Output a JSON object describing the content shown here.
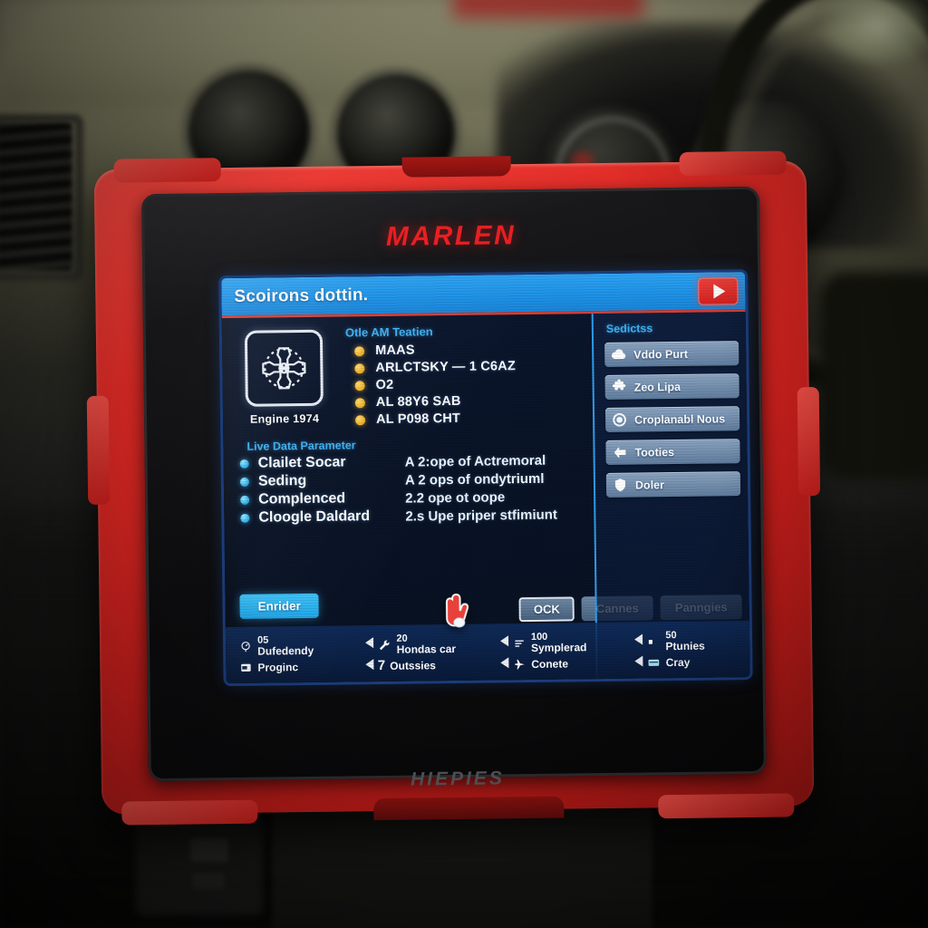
{
  "device": {
    "brand_top": "MARLEN",
    "brand_bottom": "HIEPIES",
    "shell_color": "#e02a25"
  },
  "screen": {
    "titlebar": {
      "title": "Scoirons dottin.",
      "play_icon": "play-icon",
      "bg_color": "#1e93e8",
      "underline_color": "#cf4038"
    },
    "module": {
      "icon_name": "engine-icon",
      "label": "Engine 1974"
    },
    "dtc": {
      "heading": "Otle AM Teatien",
      "bullet_color": "#f0b32c",
      "items": [
        "MAAS",
        "ARLCTSKY — 1 C6AZ",
        "O2",
        "AL 88Y6 SAB",
        "AL P098 CHT"
      ]
    },
    "live_data": {
      "heading": "Live Data Parameter",
      "bullet_color": "#2fb4ec",
      "rows": [
        {
          "name": "Clailet Socar",
          "value": "A 2:ope of Actremoral"
        },
        {
          "name": "Seding",
          "value": "A 2 ops of ondytriuml"
        },
        {
          "name": "Complenced",
          "value": "2.2 ope ot oope"
        },
        {
          "name": "Cloogle Daldard",
          "value": "2.s Upe priper stfimiunt"
        }
      ]
    },
    "sidebar": {
      "heading": "Sedictss",
      "buttons": [
        {
          "label": "Vddo Purt",
          "icon": "cloud-icon"
        },
        {
          "label": "Zeo Lipa",
          "icon": "puzzle-icon"
        },
        {
          "label": "Croplanabl Nous",
          "icon": "record-icon"
        },
        {
          "label": "Tooties",
          "icon": "arrow-left-icon"
        },
        {
          "label": "Doler",
          "icon": "shield-icon"
        }
      ]
    },
    "actions": {
      "primary": "Enrider",
      "secondary": [
        {
          "label": "OCK",
          "focused": true
        },
        {
          "label": "Cannes",
          "focused": false
        },
        {
          "label": "Panngies",
          "focused": false
        }
      ]
    },
    "status": {
      "columns": [
        {
          "lines": [
            {
              "icon": "gauge-icon",
              "num": "05",
              "label": "Dufedendy"
            },
            {
              "icon": "window-icon",
              "num": "",
              "label": "Proginc"
            }
          ],
          "has_arrows": false
        },
        {
          "lines": [
            {
              "icon": "wrench-icon",
              "num": "20",
              "label": "Hondas car"
            },
            {
              "icon": "seven-icon",
              "num": "7",
              "label": "Outssies"
            }
          ],
          "has_arrows": true
        },
        {
          "lines": [
            {
              "icon": "list-icon",
              "num": "100",
              "label": "Symplerad"
            },
            {
              "icon": "flight-icon",
              "num": "",
              "label": "Conete"
            }
          ],
          "has_arrows": true
        },
        {
          "lines": [
            {
              "icon": "small-num-icon",
              "num": "50",
              "label": "Ptunies"
            },
            {
              "icon": "card-icon",
              "num": "",
              "label": "Cray"
            }
          ],
          "has_arrows": true
        }
      ]
    },
    "cursor": "hand-pointer-cursor"
  }
}
